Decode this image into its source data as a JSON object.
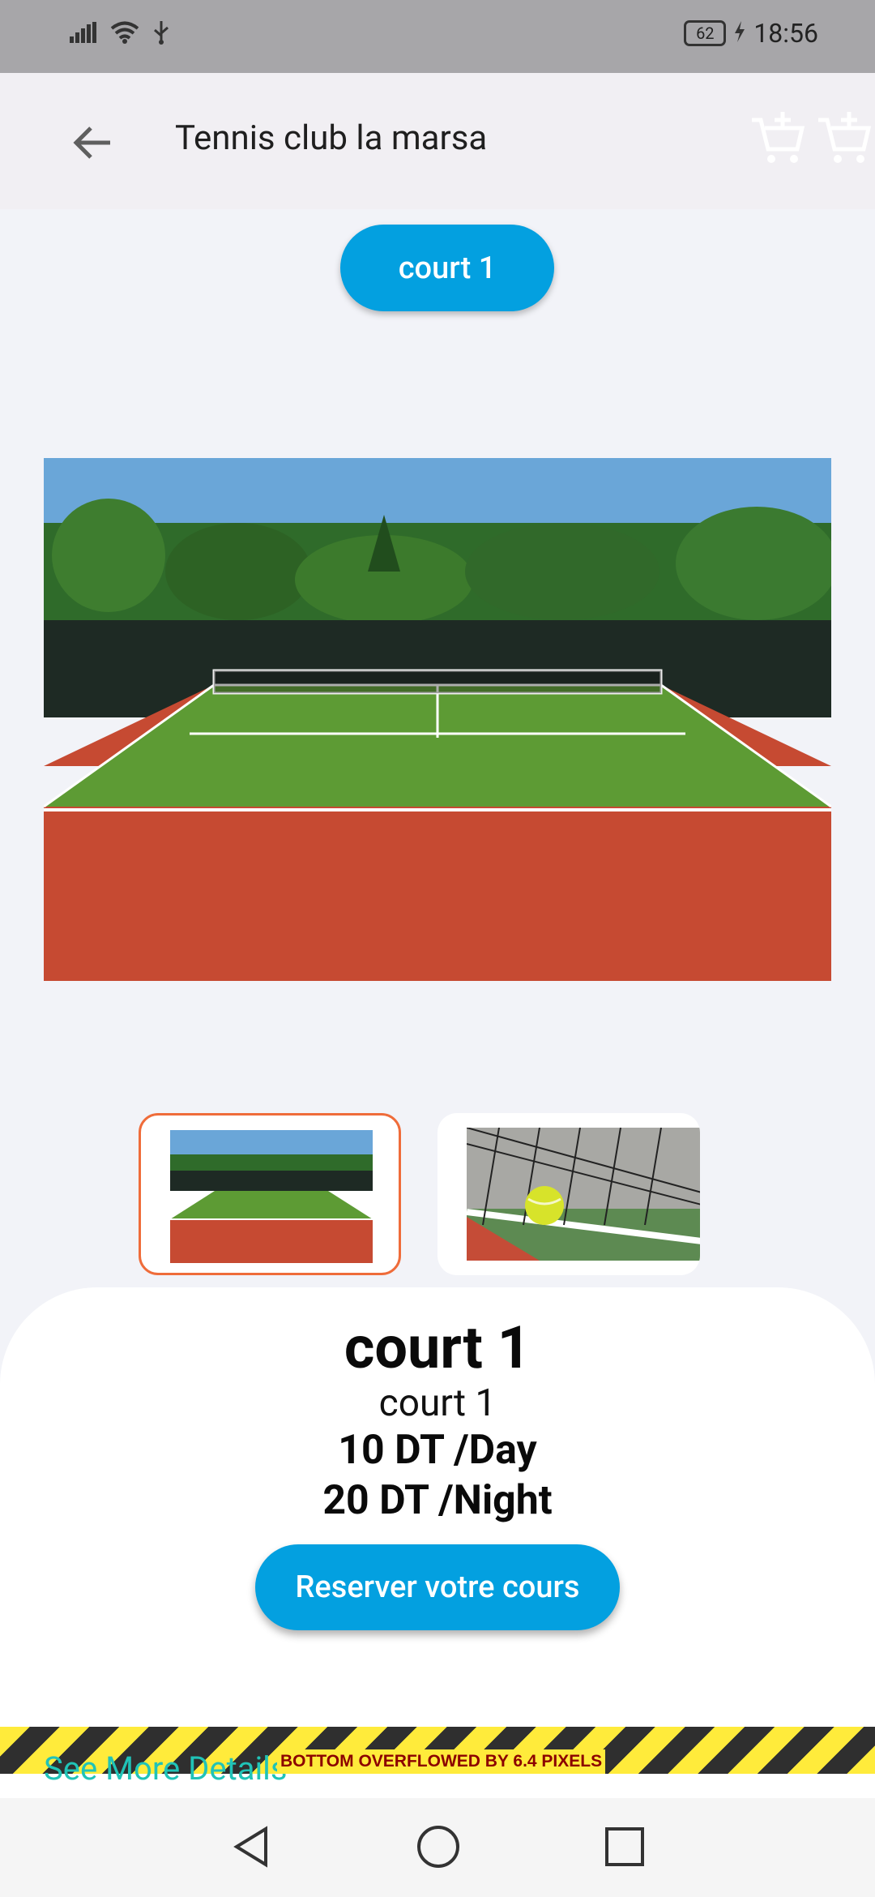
{
  "status_bar": {
    "time": "18:56",
    "battery_level": "62",
    "icons": [
      "signal-icon",
      "wifi-icon",
      "usb-icon",
      "battery-icon",
      "charging-icon"
    ]
  },
  "app_bar": {
    "title": "Tennis club la marsa",
    "back_icon": "arrow-left-icon",
    "cart_icons": [
      "add-to-cart-icon",
      "add-to-cart-icon"
    ]
  },
  "court_selector": {
    "label": "court 1"
  },
  "gallery": {
    "main_image_alt": "tennis court",
    "thumbnails": [
      {
        "name": "court-thumb",
        "selected": true
      },
      {
        "name": "tennis-ball-thumb",
        "selected": false
      }
    ]
  },
  "details": {
    "title": "court 1",
    "subtitle": "court 1",
    "price_day": "10 DT /Day",
    "price_night": "20 DT /Night",
    "reserve_label": "Reserver votre cours",
    "see_more": "See More Details"
  },
  "overflow_warning": "BOTTOM OVERFLOWED BY 6.4 PIXELS",
  "colors": {
    "primary": "#03a0e0",
    "thumb_selected_border": "#ef6c3a",
    "link": "#20c3b7"
  }
}
